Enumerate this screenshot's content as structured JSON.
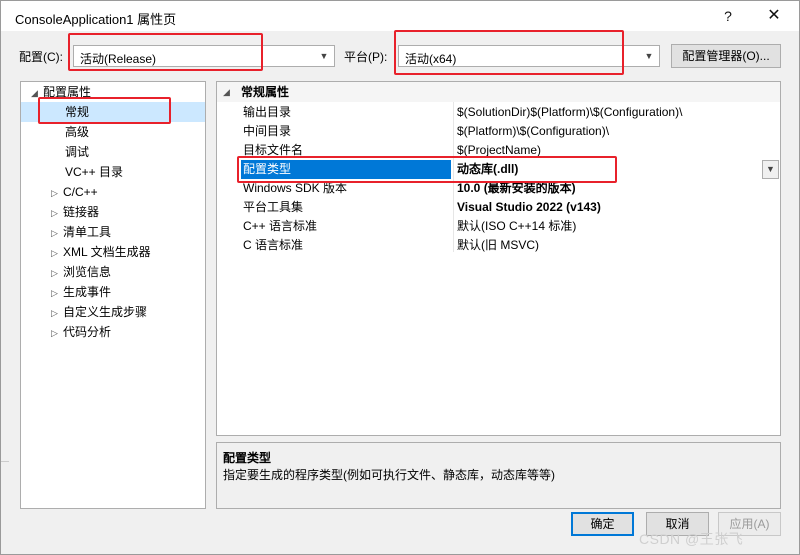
{
  "window": {
    "title": "ConsoleApplication1 属性页",
    "help_glyph": "?",
    "close_glyph": "✕"
  },
  "config": {
    "label": "配置(C):",
    "value": "活动(Release)"
  },
  "platform": {
    "label": "平台(P):",
    "value": "活动(x64)"
  },
  "config_manager_label": "配置管理器(O)...",
  "tree": {
    "root": "配置属性",
    "items": [
      {
        "label": "常规"
      },
      {
        "label": "高级"
      },
      {
        "label": "调试"
      },
      {
        "label": "VC++ 目录"
      },
      {
        "label": "C/C++"
      },
      {
        "label": "链接器"
      },
      {
        "label": "清单工具"
      },
      {
        "label": "XML 文档生成器"
      },
      {
        "label": "浏览信息"
      },
      {
        "label": "生成事件"
      },
      {
        "label": "自定义生成步骤"
      },
      {
        "label": "代码分析"
      }
    ]
  },
  "grid": {
    "category": "常规属性",
    "rows": [
      {
        "name": "输出目录",
        "value": "$(SolutionDir)$(Platform)\\$(Configuration)\\"
      },
      {
        "name": "中间目录",
        "value": "$(Platform)\\$(Configuration)\\"
      },
      {
        "name": "目标文件名",
        "value": "$(ProjectName)"
      },
      {
        "name": "配置类型",
        "value": "动态库(.dll)"
      },
      {
        "name": "Windows SDK 版本",
        "value": "10.0 (最新安装的版本)"
      },
      {
        "name": "平台工具集",
        "value": "Visual Studio 2022 (v143)"
      },
      {
        "name": "C++ 语言标准",
        "value": "默认(ISO C++14 标准)"
      },
      {
        "name": "C 语言标准",
        "value": "默认(旧 MSVC)"
      }
    ]
  },
  "description": {
    "title": "配置类型",
    "text": "指定要生成的程序类型(例如可执行文件、静态库，动态库等等)"
  },
  "buttons": {
    "ok": "确定",
    "cancel": "取消",
    "apply": "应用(A)"
  },
  "watermark": "CSDN @王张飞",
  "colors": {
    "highlight_box": "#e8212b",
    "selection": "#0078d7",
    "tree_selection": "#cce8ff"
  }
}
